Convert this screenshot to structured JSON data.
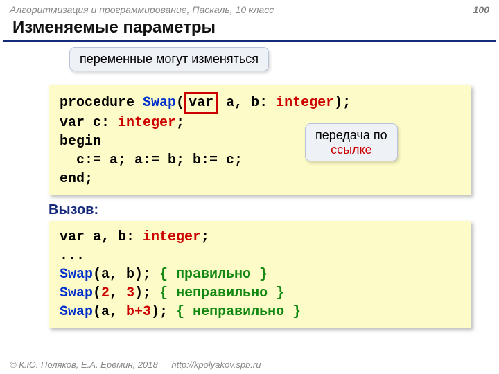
{
  "header": {
    "course": "Алгоритмизация и программирование, Паскаль, 10 класс",
    "page": "100"
  },
  "title": "Изменяемые параметры",
  "callouts": {
    "top": "переменные могут изменяться",
    "right_l1": "передача по",
    "right_l2": "ссылке"
  },
  "code1": {
    "l1_a": "procedure ",
    "l1_b": "Swap",
    "l1_c": "(",
    "l1_var": " var ",
    "l1_d": " a, b: ",
    "l1_e": "integer",
    "l1_f": ");",
    "l2_a": "var c: ",
    "l2_b": "integer",
    "l2_c": ";",
    "l3": "begin",
    "l4": "  c:= a; a:= b; b:= c;",
    "l5": "end;"
  },
  "call_label": "Вызов:",
  "code2": {
    "l1_a": "var a, b: ",
    "l1_b": "integer",
    "l1_c": ";",
    "l2": "...",
    "l3_a": "Swap",
    "l3_b": "(a, b); ",
    "l3_c": "{ правильно }",
    "l4_a": "Swap",
    "l4_b": "(",
    "l4_c": "2",
    "l4_d": ", ",
    "l4_e": "3",
    "l4_f": "); ",
    "l4_g": "{ неправильно }",
    "l5_a": "Swap",
    "l5_b": "(a, ",
    "l5_c": "b+3",
    "l5_d": "); ",
    "l5_e": "{ неправильно }"
  },
  "footer": {
    "copy": "© К.Ю. Поляков, Е.А. Ерёмин, 2018",
    "url": "http://kpolyakov.spb.ru"
  }
}
